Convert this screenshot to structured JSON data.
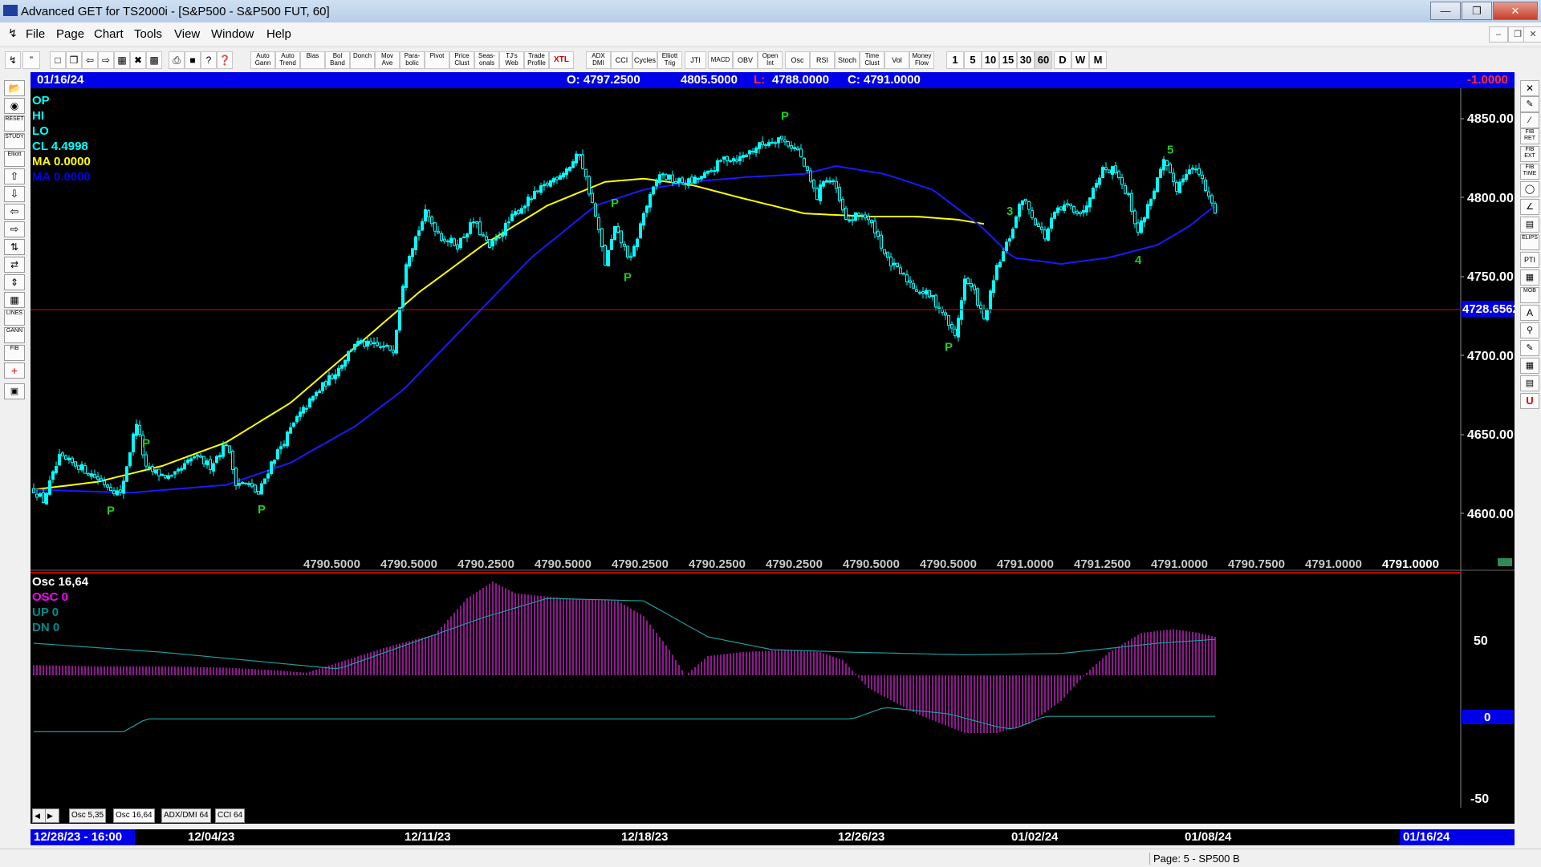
{
  "window": {
    "title": "Advanced GET for TS2000i - [S&P500 - S&P500 FUT, 60]"
  },
  "menu": [
    "File",
    "Page",
    "Chart",
    "Tools",
    "View",
    "Window",
    "Help"
  ],
  "toolbar": {
    "studies": [
      "Auto Gann",
      "Auto Trend",
      "Bias",
      "Bol Band",
      "Donch",
      "Mov Ave",
      "Para-bolic",
      "Pivot",
      "Price Clust",
      "Seas-onals",
      "TJ's Web",
      "Trade Profile",
      "XTL",
      "ADX DMI",
      "CCI",
      "Cycles",
      "Elliott Trig",
      "JTI",
      "MACD",
      "OBV",
      "Open Int",
      "Osc",
      "RSI",
      "Stoch",
      "Time Clust",
      "Vol",
      "Money Flow"
    ],
    "periods": [
      "1",
      "5",
      "10",
      "15",
      "30",
      "60",
      "D",
      "W",
      "M"
    ]
  },
  "leftbar": [
    "RESET",
    "STUDY",
    "Elliott",
    "LINES",
    "GANN",
    "FIB"
  ],
  "rightbar": [
    "FIB RET",
    "FIB EXT",
    "FIB TIME",
    "ELIPS",
    "PTI",
    "MOB",
    "A",
    "U"
  ],
  "info": {
    "date": "01/16/24",
    "open": "O: 4797.2500",
    "high": "4805.5000",
    "low_label": "L:",
    "low": "4788.0000",
    "close": "C: 4791.0000",
    "change": "-1.0000"
  },
  "legend": [
    {
      "label": "OP",
      "color": "#00ffff"
    },
    {
      "label": "HI",
      "color": "#00ffff"
    },
    {
      "label": "LO",
      "color": "#00ffff"
    },
    {
      "label": "CL  4.4998",
      "color": "#00ffff"
    },
    {
      "label": "MA  0.0000",
      "color": "#ffff00"
    },
    {
      "label": "MA  0.0000",
      "color": "#0000ff"
    }
  ],
  "price_axis": [
    "4850.00",
    "4800.00",
    "4750.00",
    "4700.00",
    "4650.00",
    "4600.00"
  ],
  "hline": {
    "label": "4728.6562",
    "color": "#c00000"
  },
  "bottom_values": [
    "4790.5000",
    "4790.5000",
    "4790.2500",
    "4790.5000",
    "4790.2500",
    "4790.2500",
    "4790.2500",
    "4790.5000",
    "4790.5000",
    "4791.0000",
    "4791.2500",
    "4791.0000",
    "4790.7500",
    "4791.0000",
    "4791.0000"
  ],
  "markers": {
    "pivots": [
      "P",
      "P",
      "P",
      "P",
      "P",
      "P",
      "P",
      "P"
    ],
    "waves": [
      "3",
      "4",
      "5"
    ]
  },
  "osc_panel": {
    "title": "Osc 16,64",
    "legend": [
      {
        "label": "OSC 0",
        "color": "#ff00ff"
      },
      {
        "label": "UP   0",
        "color": "#008b8b"
      },
      {
        "label": "DN   0",
        "color": "#008b8b"
      }
    ],
    "axis": [
      "50",
      "0",
      "-50"
    ],
    "current": "0"
  },
  "tabs": [
    "Osc 5,35",
    "Osc 16,64",
    "ADX/DMI 64",
    "CCI 64"
  ],
  "dates": {
    "cursor": "12/28/23 - 16:00",
    "labels": [
      "12/04/23",
      "12/11/23",
      "12/18/23",
      "12/26/23",
      "01/02/24",
      "01/08/24",
      "01/16/24"
    ]
  },
  "status": "Page: 5 - SP500 B",
  "chart_data": {
    "type": "candlestick",
    "ylim": [
      4580,
      4865
    ],
    "price_anchors": [
      [
        0,
        4615
      ],
      [
        3,
        4608
      ],
      [
        8,
        4635
      ],
      [
        14,
        4630
      ],
      [
        20,
        4622
      ],
      [
        27,
        4612
      ],
      [
        32,
        4658
      ],
      [
        35,
        4628
      ],
      [
        43,
        4622
      ],
      [
        50,
        4636
      ],
      [
        55,
        4630
      ],
      [
        60,
        4645
      ],
      [
        63,
        4620
      ],
      [
        67,
        4618
      ],
      [
        70,
        4612
      ],
      [
        74,
        4632
      ],
      [
        82,
        4660
      ],
      [
        88,
        4676
      ],
      [
        95,
        4692
      ],
      [
        100,
        4708
      ],
      [
        112,
        4704
      ],
      [
        116,
        4760
      ],
      [
        122,
        4790
      ],
      [
        127,
        4775
      ],
      [
        132,
        4770
      ],
      [
        137,
        4785
      ],
      [
        142,
        4768
      ],
      [
        150,
        4790
      ],
      [
        155,
        4800
      ],
      [
        162,
        4812
      ],
      [
        167,
        4820
      ],
      [
        170,
        4828
      ],
      [
        175,
        4788
      ],
      [
        178,
        4758
      ],
      [
        181,
        4780
      ],
      [
        186,
        4760
      ],
      [
        190,
        4790
      ],
      [
        195,
        4815
      ],
      [
        200,
        4810
      ],
      [
        205,
        4810
      ],
      [
        210,
        4815
      ],
      [
        215,
        4825
      ],
      [
        220,
        4825
      ],
      [
        225,
        4832
      ],
      [
        232,
        4838
      ],
      [
        238,
        4830
      ],
      [
        241,
        4815
      ],
      [
        244,
        4800
      ],
      [
        246,
        4812
      ],
      [
        249,
        4810
      ],
      [
        253,
        4785
      ],
      [
        258,
        4790
      ],
      [
        262,
        4780
      ],
      [
        266,
        4760
      ],
      [
        270,
        4752
      ],
      [
        275,
        4742
      ],
      [
        279,
        4738
      ],
      [
        283,
        4728
      ],
      [
        287,
        4712
      ],
      [
        290,
        4748
      ],
      [
        293,
        4740
      ],
      [
        296,
        4722
      ],
      [
        300,
        4755
      ],
      [
        304,
        4775
      ],
      [
        308,
        4800
      ],
      [
        312,
        4785
      ],
      [
        315,
        4775
      ],
      [
        318,
        4790
      ],
      [
        322,
        4795
      ],
      [
        327,
        4790
      ],
      [
        330,
        4808
      ],
      [
        333,
        4818
      ],
      [
        337,
        4818
      ],
      [
        341,
        4800
      ],
      [
        344,
        4778
      ],
      [
        348,
        4800
      ],
      [
        352,
        4822
      ],
      [
        356,
        4806
      ],
      [
        360,
        4820
      ],
      [
        363,
        4815
      ],
      [
        366,
        4800
      ],
      [
        368,
        4792
      ]
    ],
    "ma_yellow": [
      [
        0,
        4615
      ],
      [
        20,
        4620
      ],
      [
        40,
        4630
      ],
      [
        60,
        4645
      ],
      [
        80,
        4670
      ],
      [
        100,
        4705
      ],
      [
        120,
        4740
      ],
      [
        140,
        4770
      ],
      [
        160,
        4795
      ],
      [
        178,
        4810
      ],
      [
        190,
        4812
      ],
      [
        205,
        4808
      ],
      [
        220,
        4800
      ],
      [
        240,
        4790
      ],
      [
        260,
        4788
      ],
      [
        275,
        4788
      ],
      [
        288,
        4786
      ],
      [
        297,
        4783
      ]
    ],
    "ma_blue": [
      [
        0,
        4615
      ],
      [
        30,
        4613
      ],
      [
        60,
        4618
      ],
      [
        80,
        4632
      ],
      [
        100,
        4655
      ],
      [
        115,
        4678
      ],
      [
        135,
        4720
      ],
      [
        155,
        4762
      ],
      [
        175,
        4795
      ],
      [
        190,
        4805
      ],
      [
        205,
        4810
      ],
      [
        222,
        4813
      ],
      [
        240,
        4815
      ],
      [
        250,
        4820
      ],
      [
        265,
        4815
      ],
      [
        280,
        4805
      ],
      [
        295,
        4782
      ],
      [
        305,
        4762
      ],
      [
        320,
        4758
      ],
      [
        335,
        4762
      ],
      [
        350,
        4770
      ],
      [
        360,
        4782
      ],
      [
        368,
        4795
      ]
    ],
    "osc": [
      [
        0,
        8
      ],
      [
        20,
        7
      ],
      [
        40,
        7
      ],
      [
        60,
        6
      ],
      [
        75,
        4
      ],
      [
        85,
        2
      ],
      [
        95,
        10
      ],
      [
        110,
        22
      ],
      [
        125,
        32
      ],
      [
        135,
        60
      ],
      [
        143,
        73
      ],
      [
        150,
        64
      ],
      [
        165,
        60
      ],
      [
        182,
        58
      ],
      [
        190,
        46
      ],
      [
        198,
        20
      ],
      [
        203,
        0
      ],
      [
        210,
        15
      ],
      [
        220,
        18
      ],
      [
        235,
        20
      ],
      [
        245,
        18
      ],
      [
        252,
        12
      ],
      [
        260,
        -10
      ],
      [
        275,
        -30
      ],
      [
        290,
        -45
      ],
      [
        300,
        -45
      ],
      [
        310,
        -38
      ],
      [
        320,
        -20
      ],
      [
        328,
        2
      ],
      [
        335,
        18
      ],
      [
        345,
        33
      ],
      [
        355,
        36
      ],
      [
        363,
        33
      ],
      [
        368,
        30
      ]
    ],
    "osc_up": [
      [
        0,
        25
      ],
      [
        40,
        18
      ],
      [
        95,
        5
      ],
      [
        140,
        45
      ],
      [
        160,
        60
      ],
      [
        190,
        58
      ],
      [
        210,
        30
      ],
      [
        230,
        20
      ],
      [
        255,
        18
      ],
      [
        290,
        16
      ],
      [
        320,
        17
      ],
      [
        350,
        25
      ],
      [
        368,
        28
      ]
    ],
    "osc_dn": [
      [
        0,
        -44
      ],
      [
        28,
        -44
      ],
      [
        35,
        -34
      ],
      [
        255,
        -34
      ],
      [
        265,
        -25
      ],
      [
        285,
        -30
      ],
      [
        300,
        -40
      ],
      [
        305,
        -42
      ],
      [
        315,
        -32
      ],
      [
        368,
        -32
      ]
    ],
    "pivots": [
      [
        24,
        "L"
      ],
      [
        35,
        "H"
      ],
      [
        71,
        "L"
      ],
      [
        181,
        "H"
      ],
      [
        185,
        "L"
      ],
      [
        234,
        "H"
      ],
      [
        285,
        "L"
      ]
    ],
    "waves": [
      [
        304,
        "3"
      ],
      [
        344,
        "4"
      ],
      [
        354,
        "5"
      ]
    ]
  }
}
